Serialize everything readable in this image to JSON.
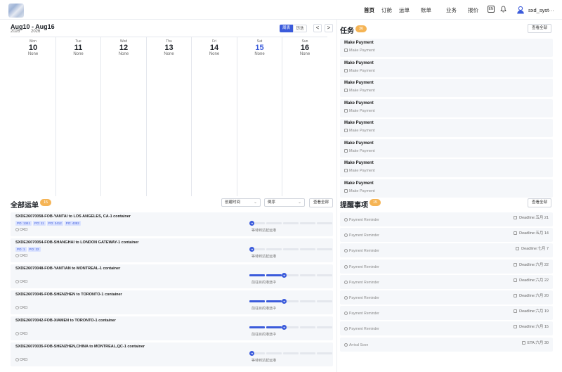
{
  "nav": {
    "items": [
      "首页",
      "订舱",
      "运单",
      "账单",
      "业务",
      "报价"
    ],
    "lang_label": "EN",
    "user_name": "sxd_syst···"
  },
  "calendar": {
    "range": "Aug10 - Aug16",
    "year_start": "2026",
    "year_end": "2026",
    "view_week": "周表",
    "view_other": "历迭",
    "prev": "<",
    "next": ">",
    "days": [
      {
        "name": "Mon",
        "num": "10",
        "status": "None"
      },
      {
        "name": "Tue",
        "num": "11",
        "status": "None"
      },
      {
        "name": "Wed",
        "num": "12",
        "status": "None"
      },
      {
        "name": "Thu",
        "num": "13",
        "status": "None"
      },
      {
        "name": "Fri",
        "num": "14",
        "status": "None"
      },
      {
        "name": "Sat",
        "num": "15",
        "status": "None"
      },
      {
        "name": "Sun",
        "num": "16",
        "status": "None"
      }
    ],
    "today_index": 5
  },
  "tasks": {
    "title": "任务",
    "count": "36",
    "view_all": "查看全部",
    "items": [
      {
        "title": "Make Payment",
        "sub": "Make Payment"
      },
      {
        "title": "Make Payment",
        "sub": "Make Payment"
      },
      {
        "title": "Make Payment",
        "sub": "Make Payment"
      },
      {
        "title": "Make Payment",
        "sub": "Make Payment"
      },
      {
        "title": "Make Payment",
        "sub": "Make Payment"
      },
      {
        "title": "Make Payment",
        "sub": "Make Payment"
      },
      {
        "title": "Make Payment",
        "sub": "Make Payment"
      },
      {
        "title": "Make Payment",
        "sub": "Make Payment"
      }
    ]
  },
  "shipments": {
    "title": "全部运单",
    "count": "15",
    "sort_field": "创建时间",
    "sort_order": "倒序",
    "view_all": "查看全部",
    "items": [
      {
        "title": "SXDE26070058-FOB-YANTAI to LOS ANGELES, CA-1 container",
        "pos": [
          "PO: 1341",
          "PO: 11",
          "PO: 2412",
          "PO: 4352"
        ],
        "crd": "CRD:",
        "status": "等待到达起运港",
        "progress": 0
      },
      {
        "title": "SXDE26070054-FOB-SHANGHAI to LONDON GATEWAY-1 container",
        "pos": [
          "PO: 1",
          "PO: 22"
        ],
        "crd": "CRD:",
        "status": "等待到达起运港",
        "progress": 0
      },
      {
        "title": "SXDE26070048-FOB-YANTIAN to MONTREAL-1 container",
        "pos": [],
        "crd": "CRD:",
        "status": "前往目的港途中",
        "progress": 2
      },
      {
        "title": "SXDE26070045-FOB-SHENZHEN to TORONTO-1 container",
        "pos": [],
        "crd": "CRD:",
        "status": "前往目的港途中",
        "progress": 2
      },
      {
        "title": "SXDE26070042-FOB-XIAMEN to TORONTO-1 container",
        "pos": [],
        "crd": "CRD:",
        "status": "前往目的港途中",
        "progress": 2
      },
      {
        "title": "SXDE26070035-FOB-SHENZHEN,CHINA to MONTREAL,QC-1 container",
        "pos": [],
        "crd": "CRD:",
        "status": "等待到达起运港",
        "progress": 0
      }
    ]
  },
  "reminders": {
    "title": "提醒事项",
    "count": "15",
    "view_all": "查看全部",
    "items": [
      {
        "type": "Payment Reminder",
        "deadline": "Deadline:五月 21"
      },
      {
        "type": "Payment Reminder",
        "deadline": "Deadline:五月 14"
      },
      {
        "type": "Payment Reminder",
        "deadline": "Deadline:七月 7"
      },
      {
        "type": "Payment Reminder",
        "deadline": "Deadline:六月 22"
      },
      {
        "type": "Payment Reminder",
        "deadline": "Deadline:六月 22"
      },
      {
        "type": "Payment Reminder",
        "deadline": "Deadline:六月 20"
      },
      {
        "type": "Payment Reminder",
        "deadline": "Deadline:六月 19"
      },
      {
        "type": "Payment Reminder",
        "deadline": "Deadline:六月 15"
      },
      {
        "type": "Arrival Soon",
        "deadline": "ETA:六月 30"
      }
    ]
  },
  "colors": {
    "accent": "#3b5bdb",
    "badge": "#f5b455",
    "card_bg": "#f5f7fa"
  }
}
